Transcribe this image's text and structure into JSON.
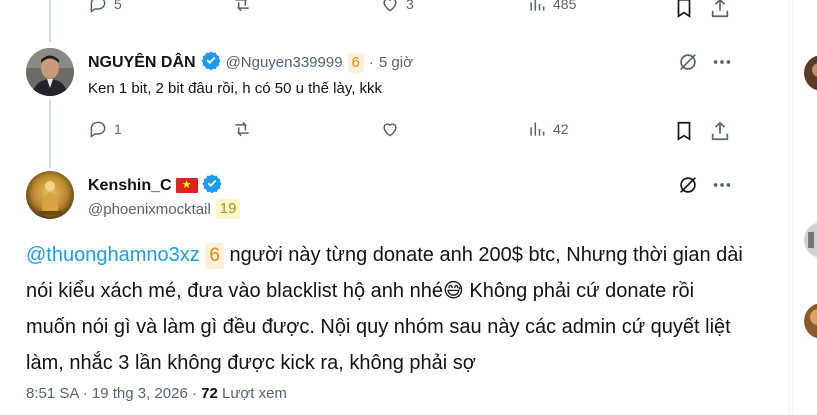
{
  "top_actions": {
    "reply_count": "5",
    "like_count": "3",
    "view_count": "485"
  },
  "reply_tweet": {
    "display_name": "NGUYÊN DÂN",
    "handle": "@Nguyen339999",
    "handle_badge": "6",
    "separator": "·",
    "time": "5 giờ",
    "text": "Ken 1 bit, 2 bit đâu rồi, h có 50 u thế lày, kkk",
    "reply_count": "1",
    "view_count": "42"
  },
  "main_tweet": {
    "display_name": "Kenshin_C",
    "flag": "🇻🇳",
    "handle": "@phoenixmocktail",
    "handle_badge": "19",
    "mention": "@thuonghamno3xz",
    "mention_badge": "6",
    "text_part1": " người này từng donate anh 200$ btc, Nhưng thời gian dài nói kiểu xách mé, đưa vào blacklist hộ anh nhé",
    "emoji": "😅",
    "text_part2": " Không phải cứ donate rồi muốn nói gì và làm gì đều được. Nội quy nhóm sau này các admin cứ quyết liệt làm, nhắc 3 lần không được kick ra, không phải sợ",
    "time": "8:51 SA",
    "dot": "·",
    "date": "19 thg 3, 2026",
    "views_number": "72",
    "views_label": "Lượt xem"
  },
  "colors": {
    "accent": "#1d9bf0",
    "muted": "#536471",
    "badge_orange_bg": "#fdf1d8",
    "badge_orange_fg": "#e8851a",
    "badge_yellow_bg": "#fbf7c9",
    "badge_yellow_fg": "#b58f1a"
  },
  "icons": [
    "reply-icon",
    "retweet-icon",
    "like-icon",
    "views-icon",
    "bookmark-icon",
    "share-icon",
    "grok-icon",
    "more-icon",
    "verified-icon"
  ]
}
